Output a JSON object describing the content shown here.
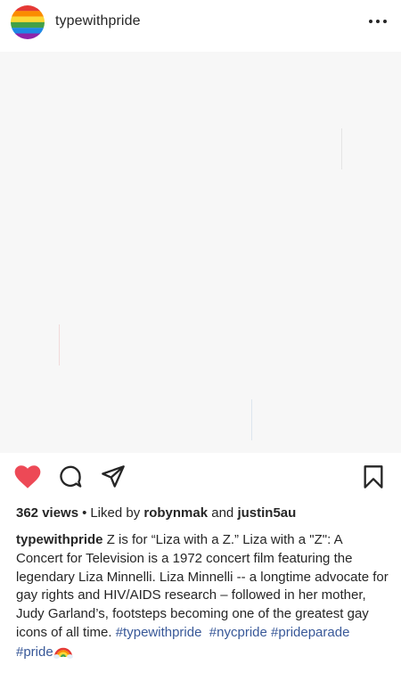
{
  "header": {
    "username": "typewithpride",
    "avatar_colors": [
      "#e53935",
      "#fb8c00",
      "#fdd835",
      "#43a047",
      "#1e88e5",
      "#8e24aa"
    ]
  },
  "colors": {
    "like_active": "#ed4956",
    "link": "#385898",
    "text": "#262626",
    "image_bg": "#f7f7f7"
  },
  "actions": {
    "like_icon": "heart-filled-icon",
    "comment_icon": "comment-bubble-icon",
    "share_icon": "paper-plane-icon",
    "save_icon": "bookmark-icon"
  },
  "stats": {
    "views": "362 views",
    "separator": "•",
    "liked_by_prefix": "Liked by",
    "liker_1": "robynmak",
    "conjunction": "and",
    "liker_2": "justin5au"
  },
  "caption": {
    "username": "typewithpride",
    "text": "Z is for “Liza with a Z.” Liza with a \"Z\": A Concert for Television is a 1972 concert film featuring the legendary Liza Minnelli.  Liza Minnelli -- a longtime advocate for gay rights and HIV/AIDS research – followed in her mother, Judy Garland’s, footsteps becoming one of the greatest gay icons of all time.",
    "hashtags": [
      "#typewithpride",
      "#nycpride",
      "#prideparade",
      "#pride"
    ],
    "emoji": "rainbow-icon"
  }
}
